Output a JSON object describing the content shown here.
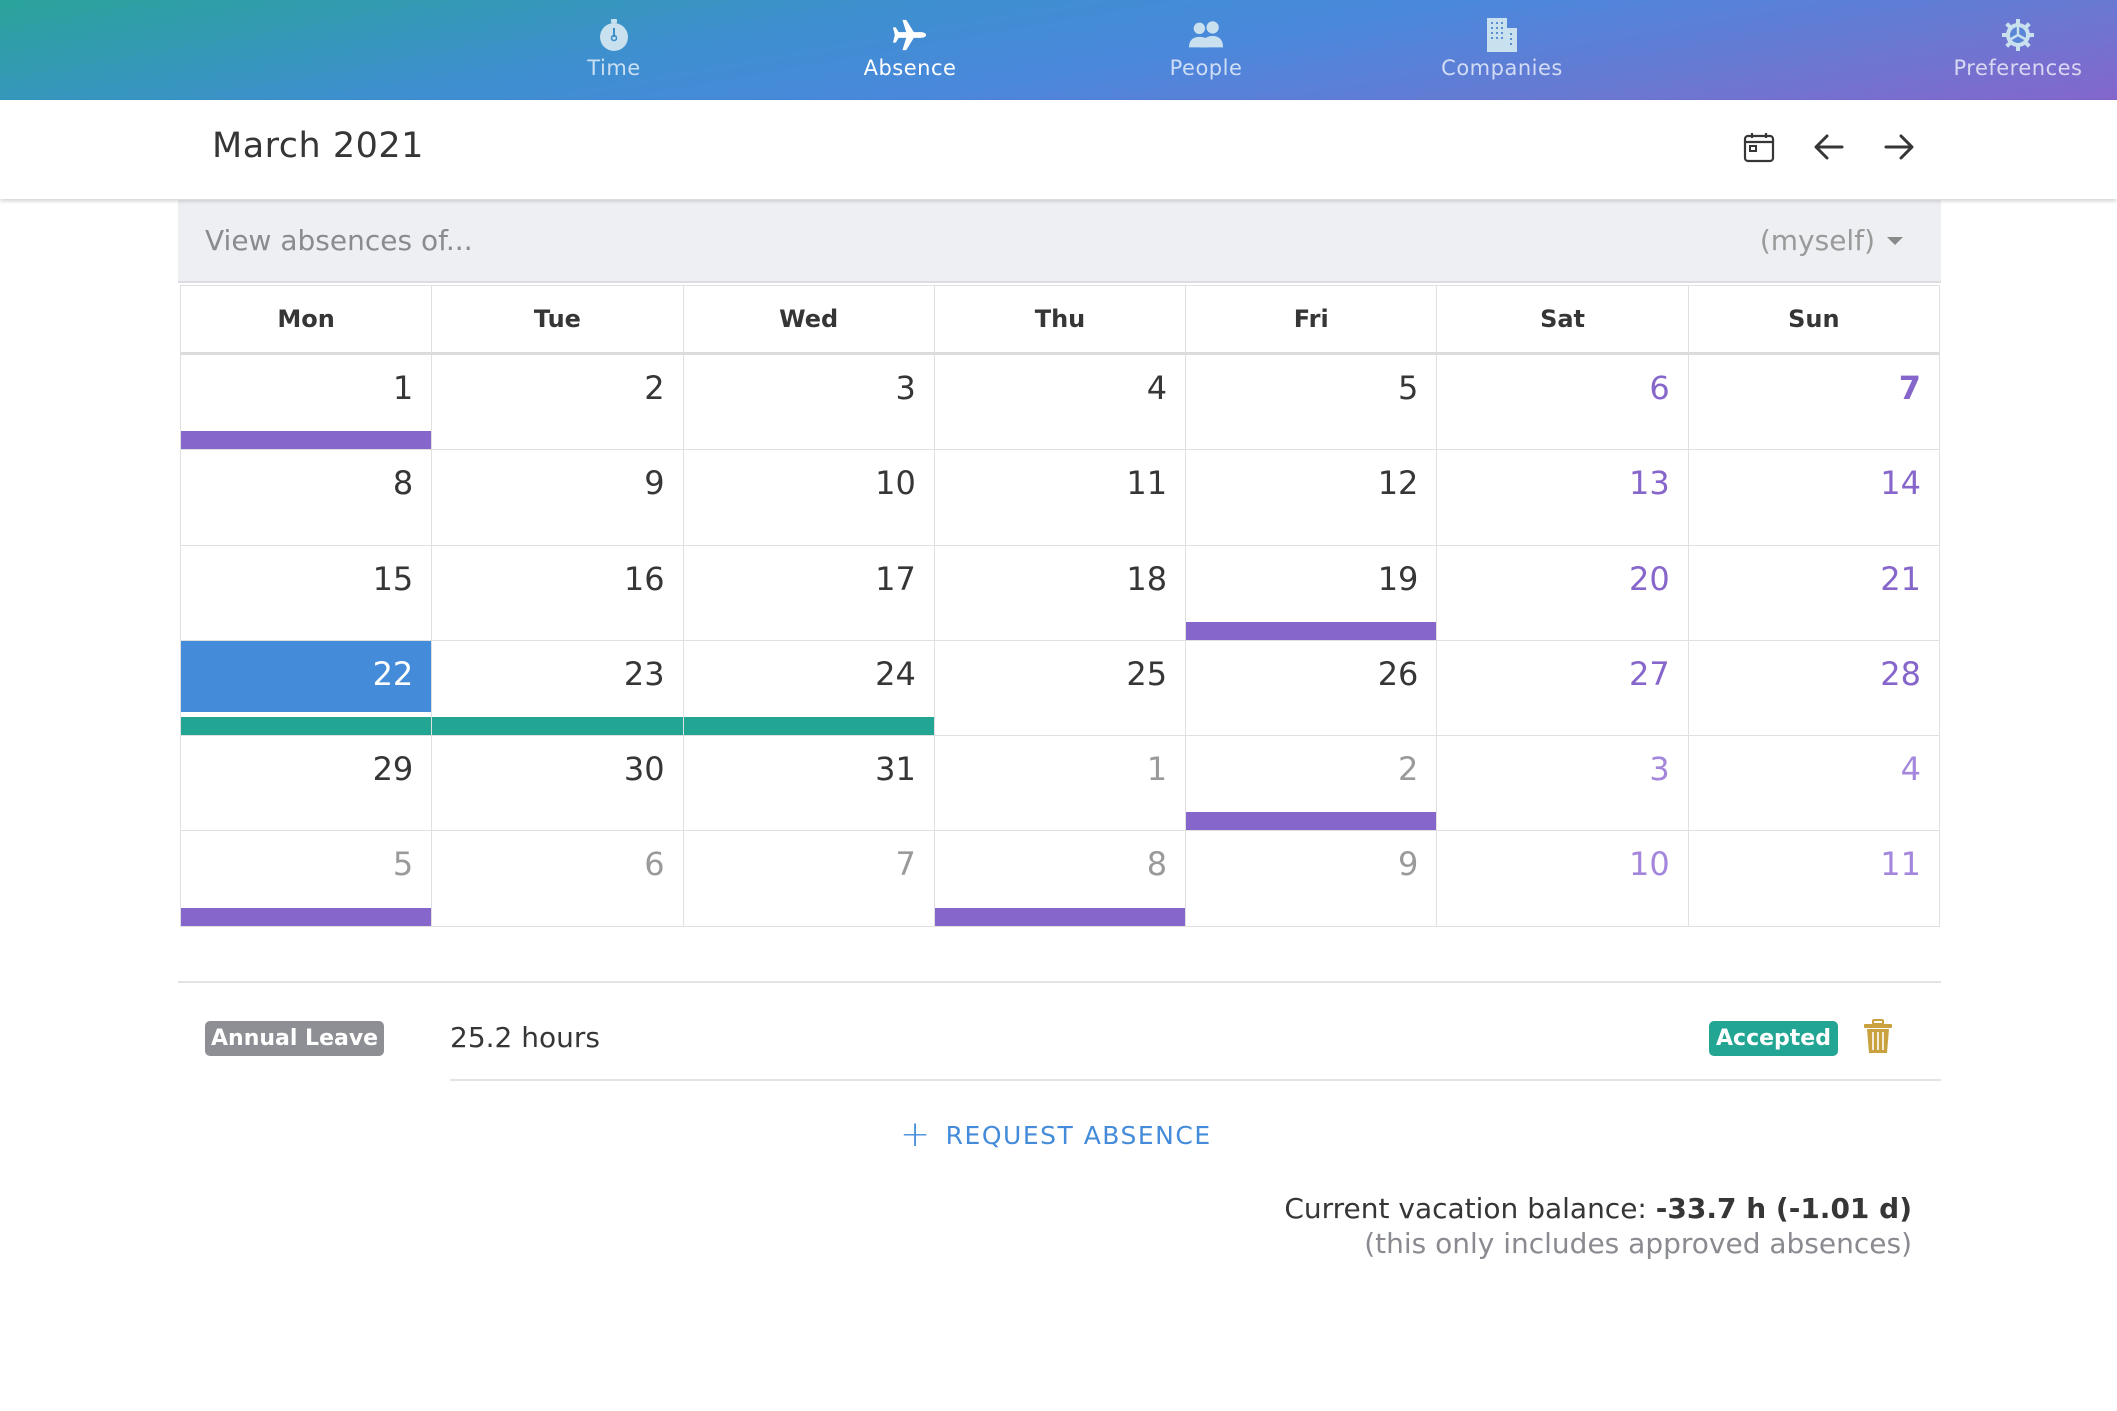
{
  "nav": {
    "items": [
      {
        "label": "Time",
        "icon": "stopwatch-icon",
        "active": false
      },
      {
        "label": "Absence",
        "icon": "airplane-icon",
        "active": true
      },
      {
        "label": "People",
        "icon": "people-icon",
        "active": false
      },
      {
        "label": "Companies",
        "icon": "building-icon",
        "active": false
      },
      {
        "label": "Preferences",
        "icon": "gear-icon",
        "active": false
      }
    ]
  },
  "header": {
    "title": "March 2021",
    "buttons": [
      {
        "name": "today-button",
        "icon": "calendar-icon"
      },
      {
        "name": "previous-month-button",
        "icon": "arrow-left-icon"
      },
      {
        "name": "next-month-button",
        "icon": "arrow-right-icon"
      }
    ]
  },
  "filter": {
    "placeholder": "View absences of...",
    "selected": "(myself)"
  },
  "calendar": {
    "weekdays": [
      "Mon",
      "Tue",
      "Wed",
      "Thu",
      "Fri",
      "Sat",
      "Sun"
    ],
    "colors": {
      "holiday_bar": "#8766cc",
      "absence_bar": "#22a593",
      "selected": "#448cd9",
      "weekend_text": "#8766cc"
    },
    "weeks": [
      [
        {
          "day": "1",
          "bar": "holiday"
        },
        {
          "day": "2"
        },
        {
          "day": "3"
        },
        {
          "day": "4"
        },
        {
          "day": "5"
        },
        {
          "day": "6",
          "weekend": true
        },
        {
          "day": "7",
          "weekend": true,
          "bold": true
        }
      ],
      [
        {
          "day": "8"
        },
        {
          "day": "9"
        },
        {
          "day": "10"
        },
        {
          "day": "11"
        },
        {
          "day": "12"
        },
        {
          "day": "13",
          "weekend": true
        },
        {
          "day": "14",
          "weekend": true
        }
      ],
      [
        {
          "day": "15"
        },
        {
          "day": "16"
        },
        {
          "day": "17"
        },
        {
          "day": "18"
        },
        {
          "day": "19",
          "bar": "holiday"
        },
        {
          "day": "20",
          "weekend": true
        },
        {
          "day": "21",
          "weekend": true
        }
      ],
      [
        {
          "day": "22",
          "selected": true,
          "bar": "absence"
        },
        {
          "day": "23",
          "bar": "absence"
        },
        {
          "day": "24",
          "bar": "absence"
        },
        {
          "day": "25"
        },
        {
          "day": "26"
        },
        {
          "day": "27",
          "weekend": true
        },
        {
          "day": "28",
          "weekend": true
        }
      ],
      [
        {
          "day": "29"
        },
        {
          "day": "30"
        },
        {
          "day": "31"
        },
        {
          "day": "1",
          "other": true
        },
        {
          "day": "2",
          "other": true,
          "bar": "holiday"
        },
        {
          "day": "3",
          "other": true,
          "weekend": true
        },
        {
          "day": "4",
          "other": true,
          "weekend": true
        }
      ],
      [
        {
          "day": "5",
          "other": true,
          "bar": "holiday"
        },
        {
          "day": "6",
          "other": true
        },
        {
          "day": "7",
          "other": true
        },
        {
          "day": "8",
          "other": true,
          "bar": "holiday"
        },
        {
          "day": "9",
          "other": true
        },
        {
          "day": "10",
          "other": true,
          "weekend": true
        },
        {
          "day": "11",
          "other": true,
          "weekend": true
        }
      ]
    ]
  },
  "absences": [
    {
      "type": "Annual Leave",
      "amount": "25.2 hours",
      "status": "Accepted",
      "status_color": "#22a593",
      "type_color": "#8d8f94"
    }
  ],
  "actions": {
    "request_absence": "REQUEST ABSENCE"
  },
  "balance": {
    "label": "Current vacation balance: ",
    "value": "-33.7 h (-1.01 d)",
    "note": "(this only includes approved absences)"
  }
}
